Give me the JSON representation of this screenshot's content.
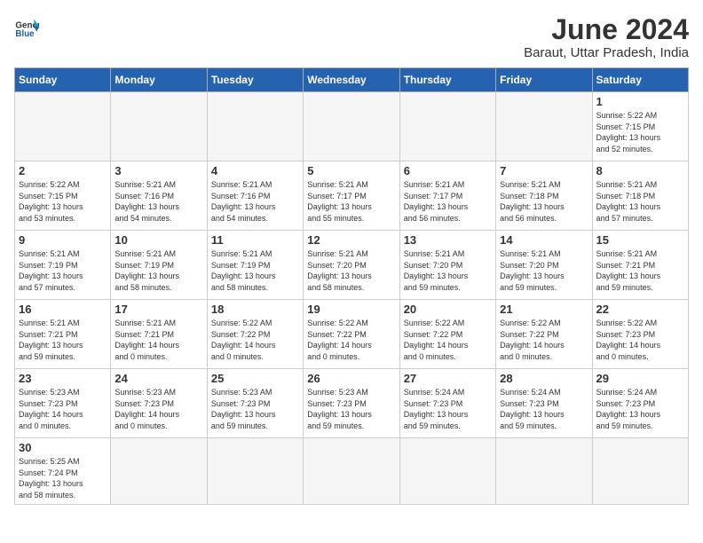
{
  "logo": {
    "text_general": "General",
    "text_blue": "Blue"
  },
  "header": {
    "title": "June 2024",
    "subtitle": "Baraut, Uttar Pradesh, India"
  },
  "weekdays": [
    "Sunday",
    "Monday",
    "Tuesday",
    "Wednesday",
    "Thursday",
    "Friday",
    "Saturday"
  ],
  "weeks": [
    [
      {
        "day": "",
        "info": ""
      },
      {
        "day": "",
        "info": ""
      },
      {
        "day": "",
        "info": ""
      },
      {
        "day": "",
        "info": ""
      },
      {
        "day": "",
        "info": ""
      },
      {
        "day": "",
        "info": ""
      },
      {
        "day": "1",
        "info": "Sunrise: 5:22 AM\nSunset: 7:15 PM\nDaylight: 13 hours\nand 52 minutes."
      }
    ],
    [
      {
        "day": "2",
        "info": "Sunrise: 5:22 AM\nSunset: 7:15 PM\nDaylight: 13 hours\nand 53 minutes."
      },
      {
        "day": "3",
        "info": "Sunrise: 5:21 AM\nSunset: 7:16 PM\nDaylight: 13 hours\nand 54 minutes."
      },
      {
        "day": "4",
        "info": "Sunrise: 5:21 AM\nSunset: 7:16 PM\nDaylight: 13 hours\nand 54 minutes."
      },
      {
        "day": "5",
        "info": "Sunrise: 5:21 AM\nSunset: 7:17 PM\nDaylight: 13 hours\nand 55 minutes."
      },
      {
        "day": "6",
        "info": "Sunrise: 5:21 AM\nSunset: 7:17 PM\nDaylight: 13 hours\nand 56 minutes."
      },
      {
        "day": "7",
        "info": "Sunrise: 5:21 AM\nSunset: 7:18 PM\nDaylight: 13 hours\nand 56 minutes."
      },
      {
        "day": "8",
        "info": "Sunrise: 5:21 AM\nSunset: 7:18 PM\nDaylight: 13 hours\nand 57 minutes."
      }
    ],
    [
      {
        "day": "9",
        "info": "Sunrise: 5:21 AM\nSunset: 7:19 PM\nDaylight: 13 hours\nand 57 minutes."
      },
      {
        "day": "10",
        "info": "Sunrise: 5:21 AM\nSunset: 7:19 PM\nDaylight: 13 hours\nand 58 minutes."
      },
      {
        "day": "11",
        "info": "Sunrise: 5:21 AM\nSunset: 7:19 PM\nDaylight: 13 hours\nand 58 minutes."
      },
      {
        "day": "12",
        "info": "Sunrise: 5:21 AM\nSunset: 7:20 PM\nDaylight: 13 hours\nand 58 minutes."
      },
      {
        "day": "13",
        "info": "Sunrise: 5:21 AM\nSunset: 7:20 PM\nDaylight: 13 hours\nand 59 minutes."
      },
      {
        "day": "14",
        "info": "Sunrise: 5:21 AM\nSunset: 7:20 PM\nDaylight: 13 hours\nand 59 minutes."
      },
      {
        "day": "15",
        "info": "Sunrise: 5:21 AM\nSunset: 7:21 PM\nDaylight: 13 hours\nand 59 minutes."
      }
    ],
    [
      {
        "day": "16",
        "info": "Sunrise: 5:21 AM\nSunset: 7:21 PM\nDaylight: 13 hours\nand 59 minutes."
      },
      {
        "day": "17",
        "info": "Sunrise: 5:21 AM\nSunset: 7:21 PM\nDaylight: 14 hours\nand 0 minutes."
      },
      {
        "day": "18",
        "info": "Sunrise: 5:22 AM\nSunset: 7:22 PM\nDaylight: 14 hours\nand 0 minutes."
      },
      {
        "day": "19",
        "info": "Sunrise: 5:22 AM\nSunset: 7:22 PM\nDaylight: 14 hours\nand 0 minutes."
      },
      {
        "day": "20",
        "info": "Sunrise: 5:22 AM\nSunset: 7:22 PM\nDaylight: 14 hours\nand 0 minutes."
      },
      {
        "day": "21",
        "info": "Sunrise: 5:22 AM\nSunset: 7:22 PM\nDaylight: 14 hours\nand 0 minutes."
      },
      {
        "day": "22",
        "info": "Sunrise: 5:22 AM\nSunset: 7:23 PM\nDaylight: 14 hours\nand 0 minutes."
      }
    ],
    [
      {
        "day": "23",
        "info": "Sunrise: 5:23 AM\nSunset: 7:23 PM\nDaylight: 14 hours\nand 0 minutes."
      },
      {
        "day": "24",
        "info": "Sunrise: 5:23 AM\nSunset: 7:23 PM\nDaylight: 14 hours\nand 0 minutes."
      },
      {
        "day": "25",
        "info": "Sunrise: 5:23 AM\nSunset: 7:23 PM\nDaylight: 13 hours\nand 59 minutes."
      },
      {
        "day": "26",
        "info": "Sunrise: 5:23 AM\nSunset: 7:23 PM\nDaylight: 13 hours\nand 59 minutes."
      },
      {
        "day": "27",
        "info": "Sunrise: 5:24 AM\nSunset: 7:23 PM\nDaylight: 13 hours\nand 59 minutes."
      },
      {
        "day": "28",
        "info": "Sunrise: 5:24 AM\nSunset: 7:23 PM\nDaylight: 13 hours\nand 59 minutes."
      },
      {
        "day": "29",
        "info": "Sunrise: 5:24 AM\nSunset: 7:23 PM\nDaylight: 13 hours\nand 59 minutes."
      }
    ],
    [
      {
        "day": "30",
        "info": "Sunrise: 5:25 AM\nSunset: 7:24 PM\nDaylight: 13 hours\nand 58 minutes."
      },
      {
        "day": "",
        "info": ""
      },
      {
        "day": "",
        "info": ""
      },
      {
        "day": "",
        "info": ""
      },
      {
        "day": "",
        "info": ""
      },
      {
        "day": "",
        "info": ""
      },
      {
        "day": "",
        "info": ""
      }
    ]
  ]
}
